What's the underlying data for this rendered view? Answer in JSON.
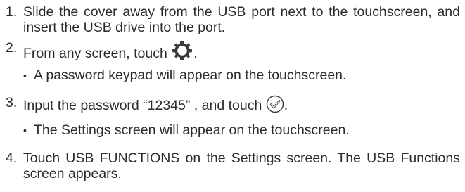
{
  "steps": [
    {
      "number": "1.",
      "text": "Slide the cover away from the USB port next to the touchscreen, and insert the USB drive into the port."
    },
    {
      "number": "2.",
      "text_before": "From any screen, touch",
      "icon": "gear-icon",
      "text_after": ".",
      "note_bullet": "•",
      "note": "A password keypad will appear on the touchscreen."
    },
    {
      "number": "3.",
      "text_before": "Input the password “12345” , and touch",
      "icon": "checkmark-circle-icon",
      "text_after": ".",
      "note_bullet": "•",
      "note": "The Settings screen will appear on the touchscreen."
    },
    {
      "number": "4.",
      "text": "Touch USB FUNCTIONS on the Settings screen. The USB Functions screen appears."
    }
  ],
  "colors": {
    "text": "#2b2b2b",
    "icon": "#3a3a3a"
  }
}
